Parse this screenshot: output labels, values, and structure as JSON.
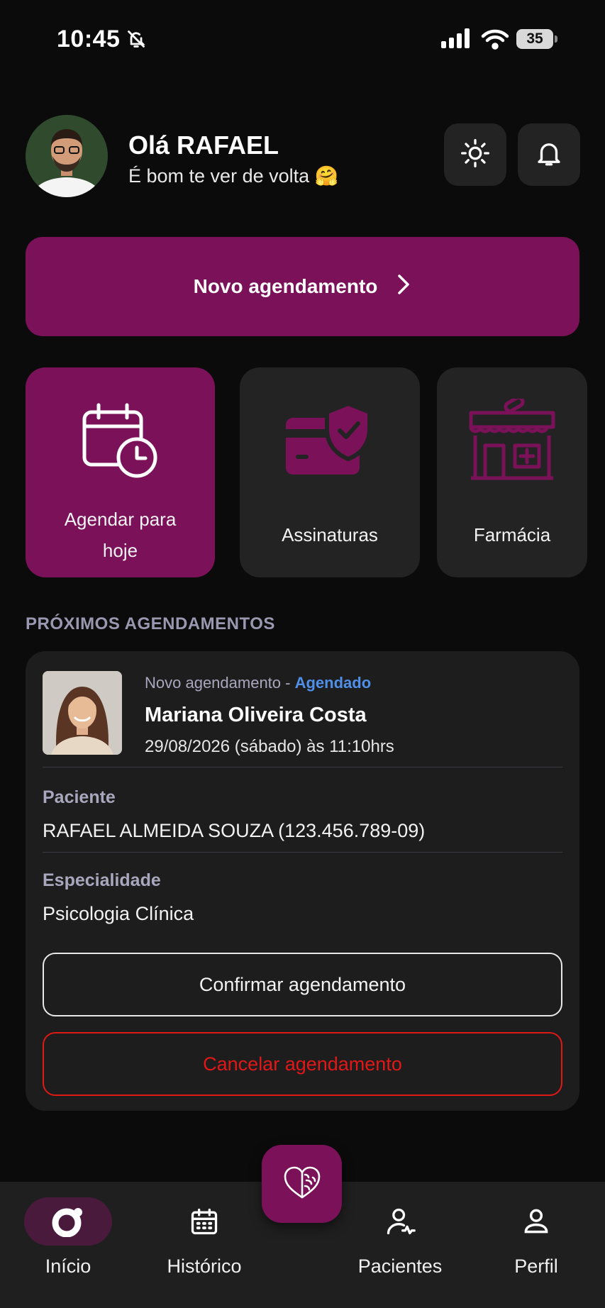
{
  "status_bar": {
    "time": "10:45",
    "battery": "35"
  },
  "header": {
    "greeting": "Olá RAFAEL",
    "subtitle": "É bom te ver de volta 🤗"
  },
  "new_appointment": {
    "label": "Novo agendamento"
  },
  "quick_actions": [
    {
      "label": "Agendar para hoje",
      "icon": "calendar-clock-icon"
    },
    {
      "label": "Assinaturas",
      "icon": "card-shield-icon"
    },
    {
      "label": "Farmácia",
      "icon": "pharmacy-store-icon"
    }
  ],
  "upcoming": {
    "section_title": "PRÓXIMOS AGENDAMENTOS",
    "card": {
      "type": "Novo agendamento",
      "separator": "-",
      "status": "Agendado",
      "professional": "Mariana Oliveira Costa",
      "when": "29/08/2026 (sábado) às 11:10hrs",
      "patient_label": "Paciente",
      "patient_value": "RAFAEL ALMEIDA SOUZA (123.456.789-09)",
      "specialty_label": "Especialidade",
      "specialty_value": "Psicologia Clínica",
      "confirm_label": "Confirmar agendamento",
      "cancel_label": "Cancelar agendamento"
    }
  },
  "bottom_nav": {
    "items": [
      {
        "label": "Início",
        "icon": "home-ring-icon",
        "active": true
      },
      {
        "label": "Histórico",
        "icon": "calendar-icon"
      },
      {
        "label": "Pacientes",
        "icon": "patients-icon"
      },
      {
        "label": "Perfil",
        "icon": "profile-icon"
      }
    ],
    "center_icon": "heart-brain-icon"
  },
  "colors": {
    "primary": "#7a1159",
    "background": "#0b0b0b",
    "surface": "#1d1d1d",
    "status_blue": "#4f8fe8",
    "danger": "#e01818"
  }
}
